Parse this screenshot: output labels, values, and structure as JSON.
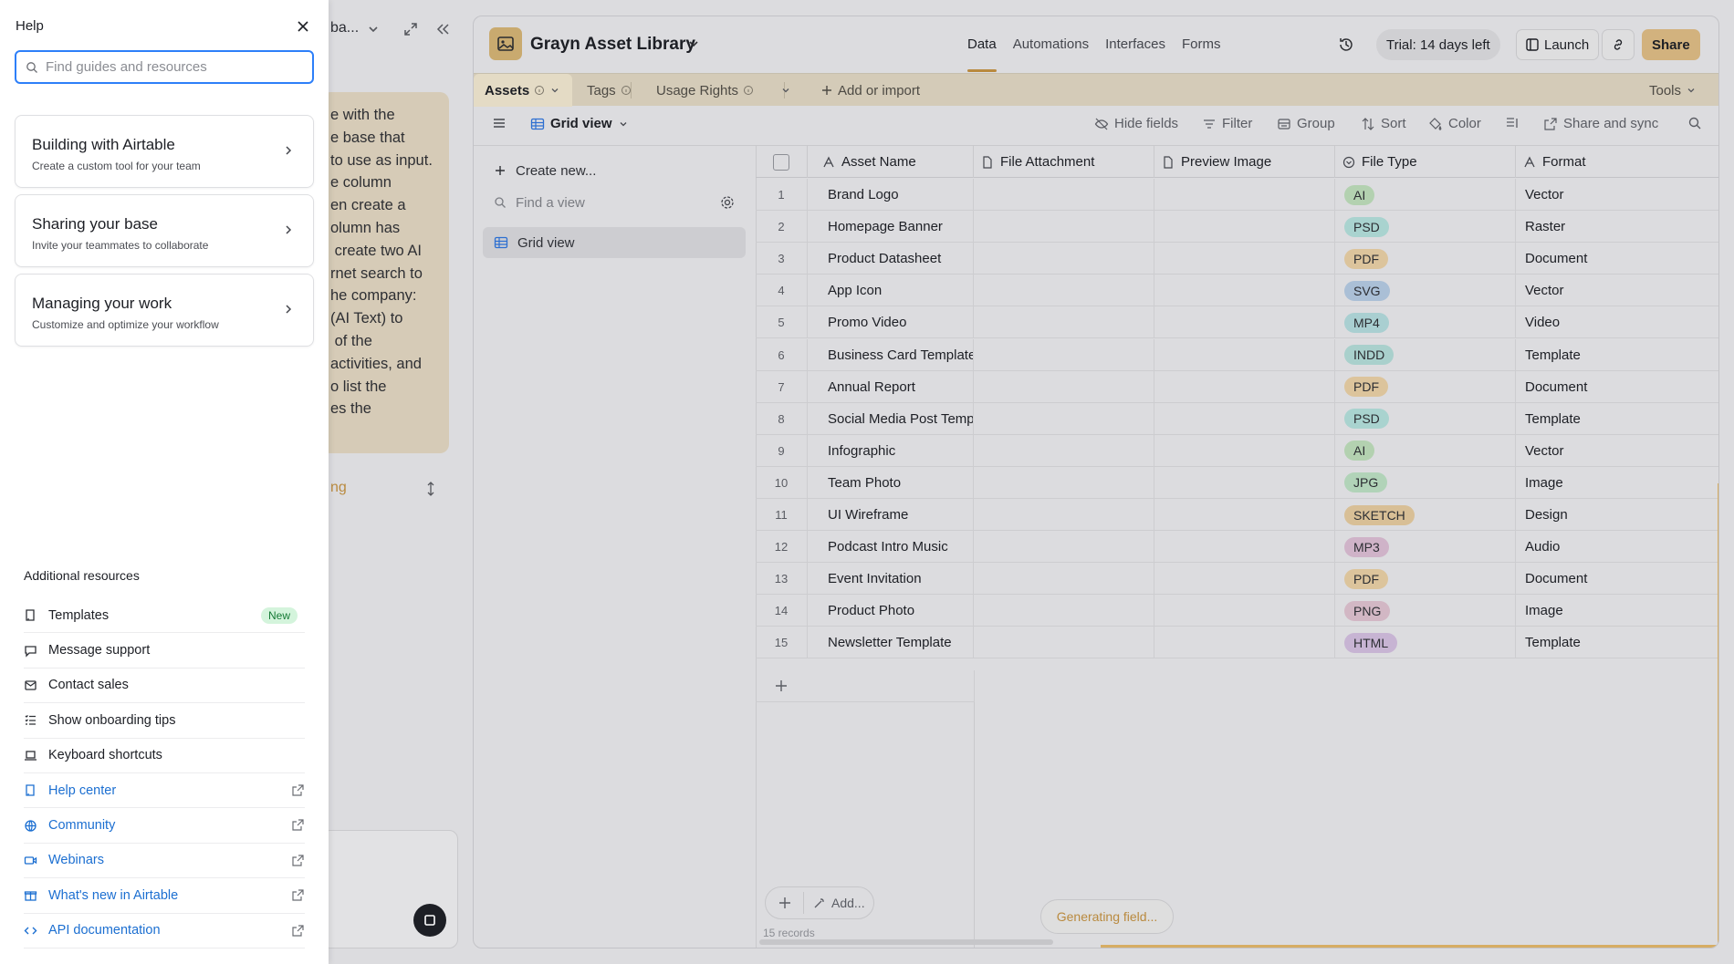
{
  "help": {
    "title": "Help",
    "search_placeholder": "Find guides and resources",
    "cards": [
      {
        "title": "Building with Airtable",
        "subtitle": "Create a custom tool for your team"
      },
      {
        "title": "Sharing your base",
        "subtitle": "Invite your teammates to collaborate"
      },
      {
        "title": "Managing your work",
        "subtitle": "Customize and optimize your workflow"
      }
    ],
    "resources_title": "Additional resources",
    "resources": [
      {
        "label": "Templates",
        "icon": "book-icon",
        "badge": "New"
      },
      {
        "label": "Message support",
        "icon": "chat-icon"
      },
      {
        "label": "Contact sales",
        "icon": "mail-icon"
      },
      {
        "label": "Show onboarding tips",
        "icon": "checklist-icon"
      },
      {
        "label": "Keyboard shortcuts",
        "icon": "laptop-icon"
      },
      {
        "label": "Help center",
        "icon": "book-icon",
        "external": true
      },
      {
        "label": "Community",
        "icon": "globe-icon",
        "external": true
      },
      {
        "label": "Webinars",
        "icon": "video-icon",
        "external": true
      },
      {
        "label": "What's new in Airtable",
        "icon": "gift-icon",
        "external": true
      },
      {
        "label": "API documentation",
        "icon": "code-icon",
        "external": true
      }
    ]
  },
  "chat": {
    "title_fragment": "ba...",
    "bubble_text": "e with the\ne base that\nto use as input.\ne column\nen create a\nolumn has\n create two AI\nrnet search to\nhe company:\n(AI Text) to\n of the\nactivities, and\no list the\nes the",
    "link_fragment": "ng"
  },
  "base": {
    "title": "Grayn Asset Library",
    "nav": [
      "Data",
      "Automations",
      "Interfaces",
      "Forms"
    ],
    "trial": "Trial: 14 days left",
    "launch": "Launch",
    "share": "Share",
    "tabs": [
      "Assets",
      "Tags",
      "Usage Rights"
    ],
    "add_or_import": "Add or import",
    "tools": "Tools",
    "view_name": "Grid view",
    "toolbar": {
      "hide_fields": "Hide fields",
      "filter": "Filter",
      "group": "Group",
      "sort": "Sort",
      "color": "Color",
      "share_sync": "Share and sync"
    },
    "views": {
      "create_new": "Create new...",
      "find_view": "Find a view",
      "grid_view": "Grid view"
    },
    "columns": [
      "Asset Name",
      "File Attachment",
      "Preview Image",
      "File Type",
      "Format"
    ],
    "rows": [
      {
        "n": "1",
        "name": "Brand Logo",
        "type": "AI",
        "format": "Vector"
      },
      {
        "n": "2",
        "name": "Homepage Banner",
        "type": "PSD",
        "format": "Raster"
      },
      {
        "n": "3",
        "name": "Product Datasheet",
        "type": "PDF",
        "format": "Document"
      },
      {
        "n": "4",
        "name": "App Icon",
        "type": "SVG",
        "format": "Vector"
      },
      {
        "n": "5",
        "name": "Promo Video",
        "type": "MP4",
        "format": "Video"
      },
      {
        "n": "6",
        "name": "Business Card Template",
        "type": "INDD",
        "format": "Template"
      },
      {
        "n": "7",
        "name": "Annual Report",
        "type": "PDF",
        "format": "Document"
      },
      {
        "n": "8",
        "name": "Social Media Post Template",
        "type": "PSD",
        "format": "Template"
      },
      {
        "n": "9",
        "name": "Infographic",
        "type": "AI",
        "format": "Vector"
      },
      {
        "n": "10",
        "name": "Team Photo",
        "type": "JPG",
        "format": "Image"
      },
      {
        "n": "11",
        "name": "UI Wireframe",
        "type": "SKETCH",
        "format": "Design"
      },
      {
        "n": "12",
        "name": "Podcast Intro Music",
        "type": "MP3",
        "format": "Audio"
      },
      {
        "n": "13",
        "name": "Event Invitation",
        "type": "PDF",
        "format": "Document"
      },
      {
        "n": "14",
        "name": "Product Photo",
        "type": "PNG",
        "format": "Image"
      },
      {
        "n": "15",
        "name": "Newsletter Template",
        "type": "HTML",
        "format": "Template"
      }
    ],
    "tag_colors": {
      "AI": "#b3d1b0",
      "PSD": "#a9d3cf",
      "PDF": "#dcc49c",
      "SVG": "#aabfd6",
      "MP4": "#a9cfd1",
      "INDD": "#a9d0cc",
      "JPG": "#b1d3b8",
      "SKETCH": "#d8bf96",
      "MP3": "#cfb3c8",
      "PNG": "#d2b7c4",
      "HTML": "#c7b4d3"
    },
    "footer": {
      "add": "Add...",
      "records": "15 records",
      "generating": "Generating field..."
    }
  }
}
